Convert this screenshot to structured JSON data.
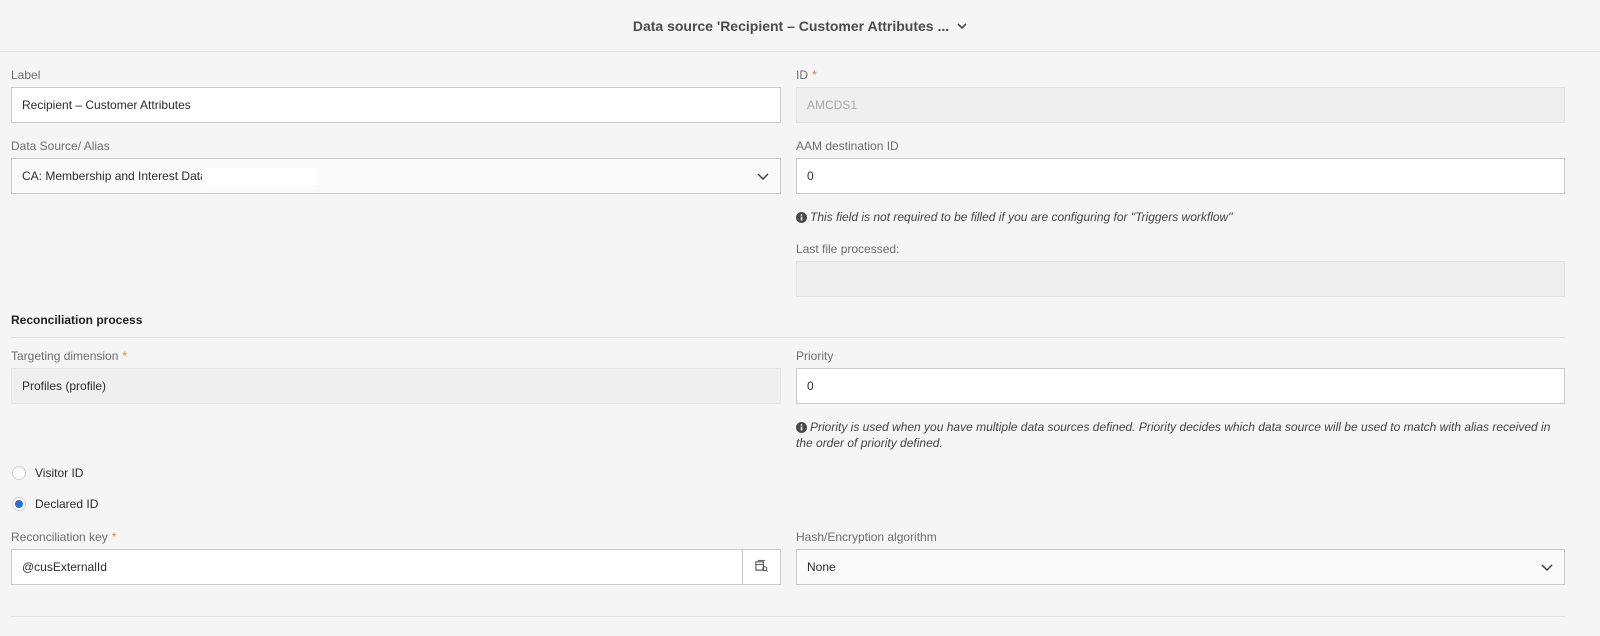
{
  "header": {
    "title": "Data source 'Recipient – Customer Attributes ..."
  },
  "form": {
    "label": {
      "label": "Label",
      "value": "Recipient – Customer Attributes"
    },
    "id": {
      "label": "ID",
      "required_mark": "*",
      "value": "AMCDS1"
    },
    "data_source_alias": {
      "label": "Data Source/ Alias",
      "value": "CA: Membership and Interest Data"
    },
    "aam_destination_id": {
      "label": "AAM destination ID",
      "value": "0",
      "hint": "This field is not required to be filled if you are configuring for \"Triggers workflow\""
    },
    "last_file_processed": {
      "label": "Last file processed:",
      "value": ""
    }
  },
  "reconciliation": {
    "title": "Reconciliation process",
    "targeting_dimension": {
      "label": "Targeting dimension",
      "required_mark": "*",
      "value": "Profiles (profile)"
    },
    "priority": {
      "label": "Priority",
      "value": "0",
      "hint": "Priority is used when you have multiple data sources defined. Priority decides which data source will be used to match with alias received in the order of priority defined."
    },
    "id_type": {
      "options": [
        {
          "label": "Visitor ID",
          "checked": false
        },
        {
          "label": "Declared ID",
          "checked": true
        }
      ]
    },
    "reconciliation_key": {
      "label": "Reconciliation key",
      "required_mark": "*",
      "value": "@cusExternalId"
    },
    "hash_algorithm": {
      "label": "Hash/Encryption algorithm",
      "value": "None"
    }
  },
  "colors": {
    "accent": "#2c6fd4",
    "required": "#e68619",
    "background": "#f5f5f5"
  }
}
